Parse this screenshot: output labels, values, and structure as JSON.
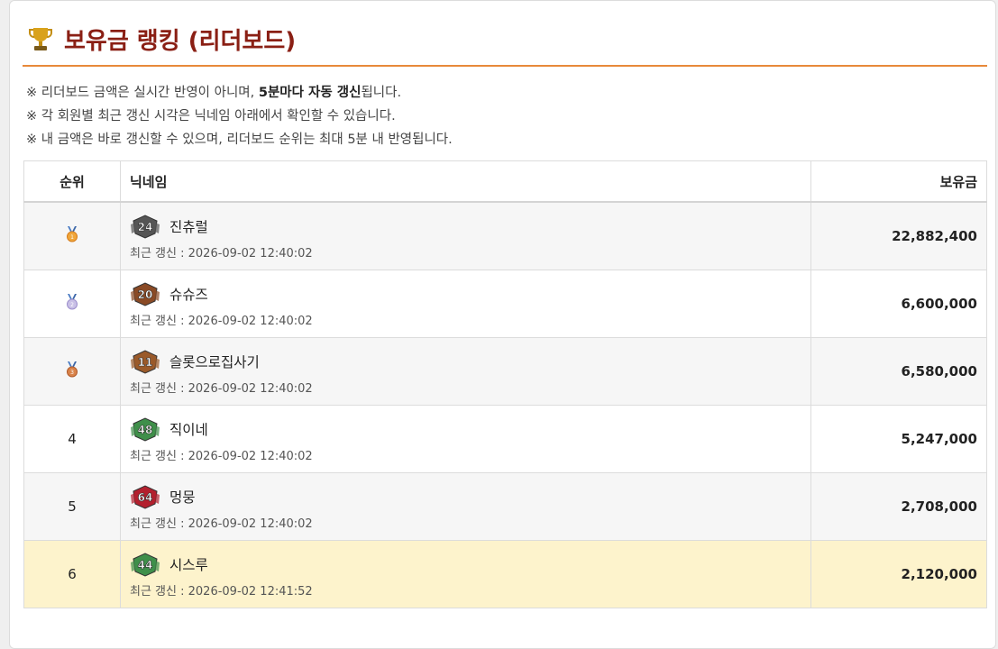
{
  "header": {
    "title": "보유금 랭킹 (리더보드)",
    "trophy_icon": "trophy-icon",
    "accent": "#e8893a",
    "title_color": "#8a1f14"
  },
  "notices": [
    {
      "prefix": "※ 리더보드 금액은 실시간 반영이 아니며, ",
      "strong": "5분마다 자동 갱신",
      "suffix": "됩니다."
    },
    {
      "prefix": "※ 각 회원별 최근 갱신 시각은 닉네임 아래에서 확인할 수 있습니다.",
      "strong": "",
      "suffix": ""
    },
    {
      "prefix": "※ 내 금액은 바로 갱신할 수 있으며, 리더보드 순위는 최대 5분 내 반영됩니다.",
      "strong": "",
      "suffix": ""
    }
  ],
  "table": {
    "headers": {
      "rank": "순위",
      "nickname": "닉네임",
      "amount": "보유금"
    },
    "updated_prefix": "최근 갱신 : ",
    "rows": [
      {
        "rank": "1",
        "medal": "gold",
        "level": "24",
        "level_color": "#555555",
        "nickname": "진츄럴",
        "updated": "2026-09-02 12:40:02",
        "amount": "22,882,400"
      },
      {
        "rank": "2",
        "medal": "silver",
        "level": "20",
        "level_color": "#8a4a25",
        "nickname": "슈슈즈",
        "updated": "2026-09-02 12:40:02",
        "amount": "6,600,000"
      },
      {
        "rank": "3",
        "medal": "bronze",
        "level": "11",
        "level_color": "#9a5a2a",
        "nickname": "슬롯으로집사기",
        "updated": "2026-09-02 12:40:02",
        "amount": "6,580,000"
      },
      {
        "rank": "4",
        "medal": "",
        "level": "48",
        "level_color": "#3f8f4a",
        "nickname": "직이네",
        "updated": "2026-09-02 12:40:02",
        "amount": "5,247,000"
      },
      {
        "rank": "5",
        "medal": "",
        "level": "64",
        "level_color": "#b3202e",
        "nickname": "멍뭉",
        "updated": "2026-09-02 12:40:02",
        "amount": "2,708,000"
      },
      {
        "rank": "6",
        "medal": "",
        "level": "44",
        "level_color": "#3f8f4a",
        "nickname": "시스루",
        "updated": "2026-09-02 12:41:52",
        "amount": "2,120,000"
      }
    ]
  }
}
